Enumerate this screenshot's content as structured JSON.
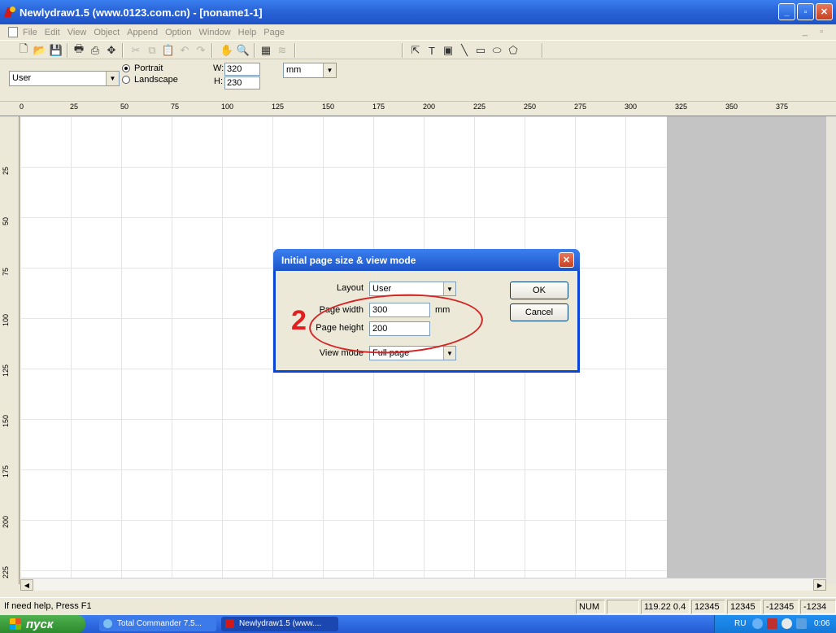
{
  "window": {
    "title": "Newlydraw1.5 (www.0123.com.cn) - [noname1-1]"
  },
  "menu": [
    "File",
    "Edit",
    "View",
    "Object",
    "Append",
    "Option",
    "Window",
    "Help",
    "Page"
  ],
  "propbar": {
    "layout_value": "User",
    "portrait_label": "Portrait",
    "landscape_label": "Landscape",
    "orientation": "Portrait",
    "w_label": "W:",
    "w_value": "320",
    "h_label": "H:",
    "h_value": "230",
    "unit_value": "mm"
  },
  "ruler_h": [
    "0",
    "25",
    "50",
    "75",
    "100",
    "125",
    "150",
    "175",
    "200",
    "225",
    "250",
    "275",
    "300",
    "325",
    "350",
    "375"
  ],
  "ruler_v": [
    "25",
    "50",
    "75",
    "100",
    "125",
    "150",
    "175",
    "200",
    "225"
  ],
  "dialog": {
    "title": "Initial page size & view mode",
    "layout_label": "Layout",
    "layout_value": "User",
    "width_label": "Page width",
    "width_value": "300",
    "width_unit": "mm",
    "height_label": "Page height",
    "height_value": "200",
    "view_label": "View mode",
    "view_value": "Full page",
    "ok_label": "OK",
    "cancel_label": "Cancel"
  },
  "annotation": {
    "step": "2"
  },
  "status": {
    "help": "If need help, Press F1",
    "num": "NUM",
    "coord_x": "119.22",
    "coord_y": "0.4",
    "f1": "12345",
    "f2": "12345",
    "f3": "-12345",
    "f4": "-1234"
  },
  "taskbar": {
    "start": "пуск",
    "tasks": [
      "Total Commander 7.5...",
      "Newlydraw1.5 (www...."
    ],
    "lang": "RU",
    "clock": "0:06"
  }
}
